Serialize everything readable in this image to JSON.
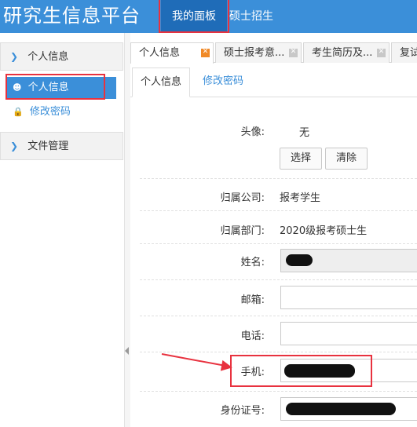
{
  "header": {
    "app_title": "研究生信息平台",
    "nav": [
      {
        "label": "我的面板"
      },
      {
        "label": "硕士招生"
      }
    ]
  },
  "sidebar": {
    "sections": [
      {
        "title": "个人信息",
        "expanded": true,
        "items": [
          {
            "label": "个人信息",
            "icon": "user-icon",
            "active": true
          },
          {
            "label": "修改密码",
            "icon": "lock-icon",
            "active": false
          }
        ]
      },
      {
        "title": "文件管理",
        "expanded": false,
        "items": []
      }
    ]
  },
  "tabs": [
    {
      "label": "个人信息"
    },
    {
      "label": "硕士报考意..."
    },
    {
      "label": "考生简历及..."
    },
    {
      "label": "复试"
    }
  ],
  "subtabs": [
    {
      "label": "个人信息"
    },
    {
      "label": "修改密码"
    }
  ],
  "form": {
    "avatar_label": "头像:",
    "avatar_value": "无",
    "choose_button": "选择",
    "clear_button": "清除",
    "company_label": "归属公司:",
    "company_value": "报考学生",
    "dept_label": "归属部门:",
    "dept_value": "2020级报考硕士生",
    "name_label": "姓名:",
    "email_label": "邮箱:",
    "phone_label": "电话:",
    "mobile_label": "手机:",
    "id_label": "身份证号:"
  },
  "colors": {
    "primary": "#3b8fd9",
    "nav_active": "#1f6cb8",
    "highlight": "#e8323f"
  }
}
